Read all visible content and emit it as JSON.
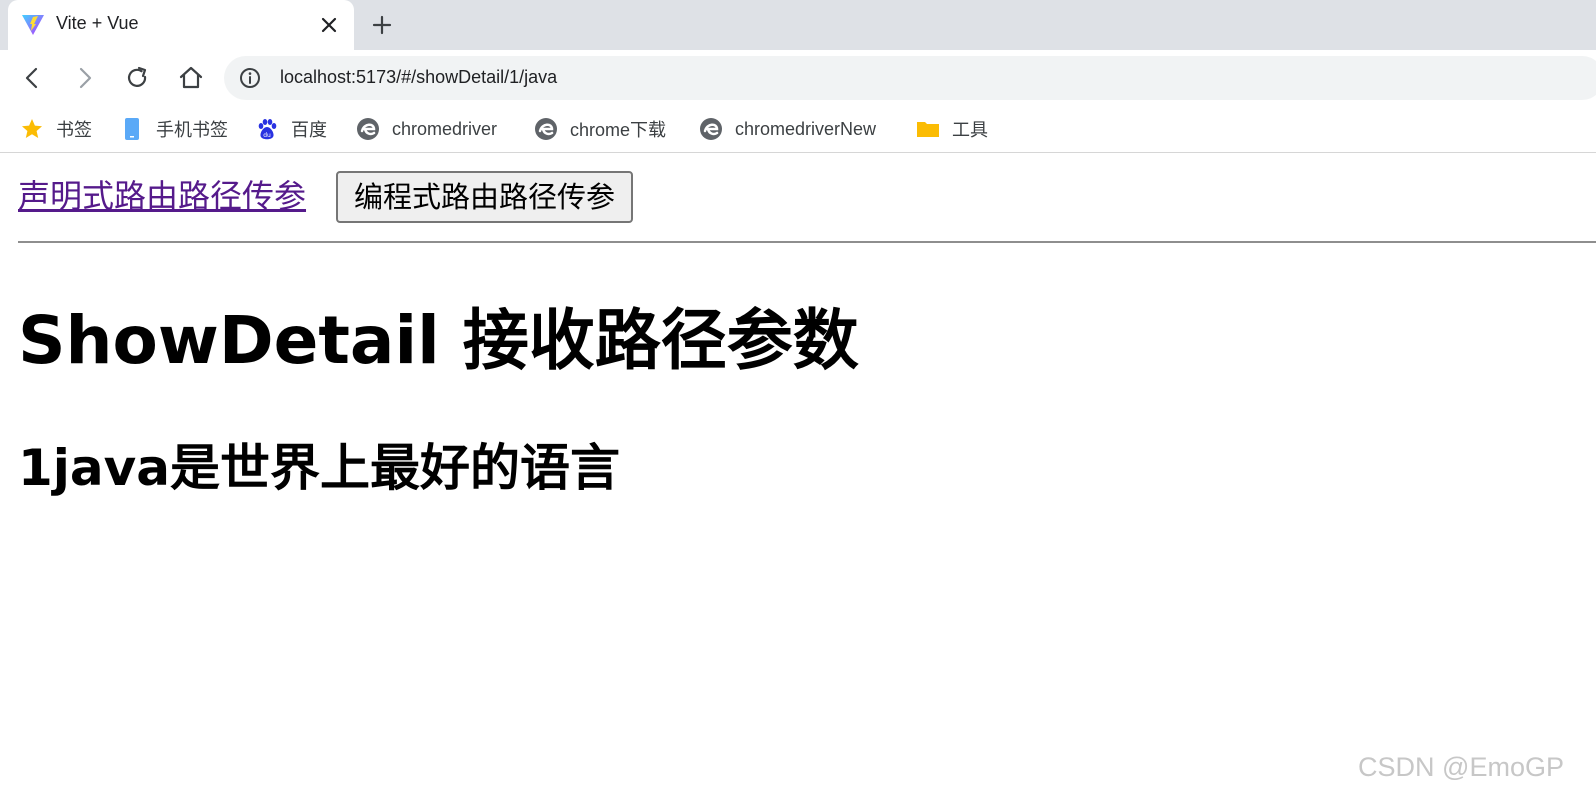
{
  "browser": {
    "tab": {
      "title": "Vite + Vue",
      "favicon": "vite-logo-icon"
    },
    "new_tab_icon": "plus-icon",
    "nav": {
      "back_icon": "back-arrow-icon",
      "forward_icon": "forward-arrow-icon",
      "reload_icon": "reload-icon",
      "home_icon": "home-icon"
    },
    "address_bar": {
      "url": "localhost:5173/#/showDetail/1/java",
      "info_icon": "info-icon"
    },
    "bookmarks": [
      {
        "label": "书签",
        "icon": "star-icon",
        "color": "#fbbc04"
      },
      {
        "label": "手机书签",
        "icon": "mobile-icon",
        "color": "#5aa9f7"
      },
      {
        "label": "百度",
        "icon": "baidu-paw-icon",
        "color": "#2932e1"
      },
      {
        "label": "chromedriver",
        "icon": "edge-logo-icon",
        "color": "#5f6368"
      },
      {
        "label": "chrome下载",
        "icon": "edge-logo-icon",
        "color": "#5f6368"
      },
      {
        "label": "chromedriverNew",
        "icon": "edge-logo-icon",
        "color": "#5f6368"
      },
      {
        "label": "工具",
        "icon": "folder-icon",
        "color": "#fbbc04"
      }
    ]
  },
  "page": {
    "router_link_label": "声明式路由路径传参",
    "programmatic_button_label": "编程式路由路径传参",
    "heading": "ShowDetail 接收路径参数",
    "detail_text": "1java是世界上最好的语言",
    "link_color": "#551a8b"
  },
  "watermark": "CSDN @EmoGP"
}
